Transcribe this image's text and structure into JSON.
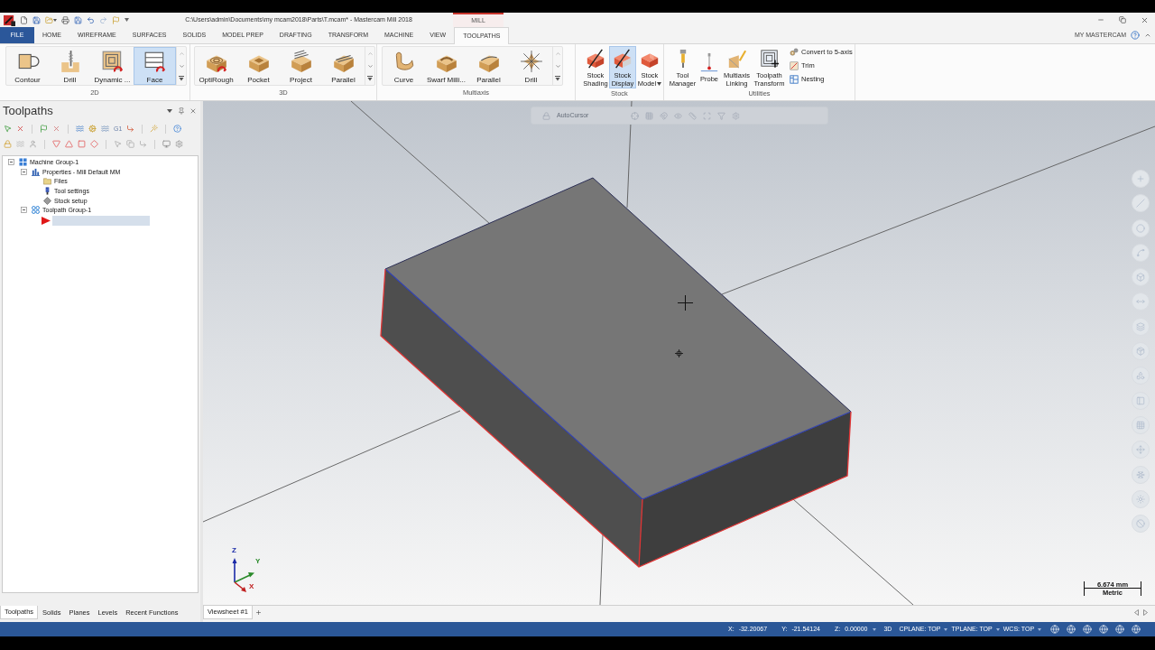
{
  "window": {
    "title": "C:\\Users\\admin\\Documents\\my mcam2018\\Parts\\T.mcam* - Mastercam Mill 2018",
    "context_tab": "MILL"
  },
  "ribbon_tabs": [
    {
      "label": "FILE",
      "kind": "file",
      "selected": false
    },
    {
      "label": "HOME",
      "kind": "tab",
      "selected": false
    },
    {
      "label": "WIREFRAME",
      "kind": "tab",
      "selected": false
    },
    {
      "label": "SURFACES",
      "kind": "tab",
      "selected": false
    },
    {
      "label": "SOLIDS",
      "kind": "tab",
      "selected": false
    },
    {
      "label": "MODEL PREP",
      "kind": "tab",
      "selected": false
    },
    {
      "label": "DRAFTING",
      "kind": "tab",
      "selected": false
    },
    {
      "label": "TRANSFORM",
      "kind": "tab",
      "selected": false
    },
    {
      "label": "MACHINE",
      "kind": "tab",
      "selected": false
    },
    {
      "label": "VIEW",
      "kind": "tab",
      "selected": false
    },
    {
      "label": "TOOLPATHS",
      "kind": "tab",
      "selected": true
    }
  ],
  "account": {
    "label": "MY MASTERCAM"
  },
  "ribbon_groups": [
    {
      "title": "2D",
      "kind": "gallery",
      "buttons": [
        {
          "label": "Contour",
          "kind": "large",
          "selected": false
        },
        {
          "label": "Drill",
          "kind": "large",
          "selected": false
        },
        {
          "label": "Dynamic ...",
          "kind": "large",
          "selected": false
        },
        {
          "label": "Face",
          "kind": "large",
          "selected": true
        }
      ]
    },
    {
      "title": "3D",
      "kind": "gallery",
      "buttons": [
        {
          "label": "OptiRough",
          "kind": "large",
          "selected": false
        },
        {
          "label": "Pocket",
          "kind": "large",
          "selected": false
        },
        {
          "label": "Project",
          "kind": "large",
          "selected": false
        },
        {
          "label": "Parallel",
          "kind": "large",
          "selected": false
        }
      ]
    },
    {
      "title": "Multiaxis",
      "kind": "gallery",
      "buttons": [
        {
          "label": "Curve",
          "kind": "large",
          "selected": false
        },
        {
          "label": "Swarf Milli...",
          "kind": "large",
          "selected": false
        },
        {
          "label": "Parallel",
          "kind": "large",
          "selected": false
        },
        {
          "label": "Drill",
          "kind": "large",
          "selected": false
        }
      ]
    },
    {
      "title": "Stock",
      "kind": "panel",
      "buttons": [
        {
          "label": "Stock Shading",
          "kind": "large",
          "selected": false
        },
        {
          "label": "Stock Display",
          "kind": "large",
          "selected": true
        },
        {
          "label": "Stock Model",
          "kind": "large",
          "selected": false,
          "dropdown": true
        }
      ]
    },
    {
      "title": "Utilities",
      "kind": "panel",
      "buttons": [
        {
          "label": "Tool Manager",
          "kind": "large",
          "selected": false
        },
        {
          "label": "Probe",
          "kind": "large",
          "selected": false
        },
        {
          "label": "Multiaxis Linking",
          "kind": "large",
          "selected": false
        },
        {
          "label": "Toolpath Transform",
          "kind": "large",
          "selected": false
        },
        {
          "label": "Convert to 5-axis",
          "kind": "small",
          "selected": false
        },
        {
          "label": "Trim",
          "kind": "small",
          "selected": false
        },
        {
          "label": "Nesting",
          "kind": "small",
          "selected": false
        }
      ]
    }
  ],
  "panel": {
    "title": "Toolpaths",
    "toolbar_text": "G1",
    "tree": [
      {
        "label": "Machine Group-1",
        "kind": "machine_group",
        "expanded": true,
        "children": [
          {
            "label": "Properties - Mill Default MM",
            "kind": "properties",
            "expanded": true,
            "children": [
              {
                "label": "Files",
                "kind": "files"
              },
              {
                "label": "Tool settings",
                "kind": "tool"
              },
              {
                "label": "Stock setup",
                "kind": "stock"
              }
            ]
          },
          {
            "label": "Toolpath Group-1",
            "kind": "toolpath_group",
            "expanded": true,
            "insert_arrow": true
          }
        ]
      }
    ],
    "tabs": [
      {
        "label": "Toolpaths",
        "selected": true
      },
      {
        "label": "Solids",
        "selected": false
      },
      {
        "label": "Planes",
        "selected": false
      },
      {
        "label": "Levels",
        "selected": false
      },
      {
        "label": "Recent Functions",
        "selected": false
      }
    ]
  },
  "viewport": {
    "toolbar_text": "AutoCursor",
    "axes": {
      "z": "Z",
      "y": "Y",
      "x": "X"
    },
    "scale": {
      "value": "6.674 mm",
      "unit": "Metric"
    },
    "sheets": [
      {
        "label": "Viewsheet #1",
        "selected": true
      }
    ]
  },
  "status_bar": {
    "coords": [
      {
        "label": "X:",
        "value": "-32.20067"
      },
      {
        "label": "Y:",
        "value": "-21.54124"
      },
      {
        "label": "Z:",
        "value": "0.00000"
      }
    ],
    "mode": "3D",
    "planes": [
      "CPLANE: TOP",
      "TPLANE: TOP",
      "WCS: TOP"
    ]
  }
}
